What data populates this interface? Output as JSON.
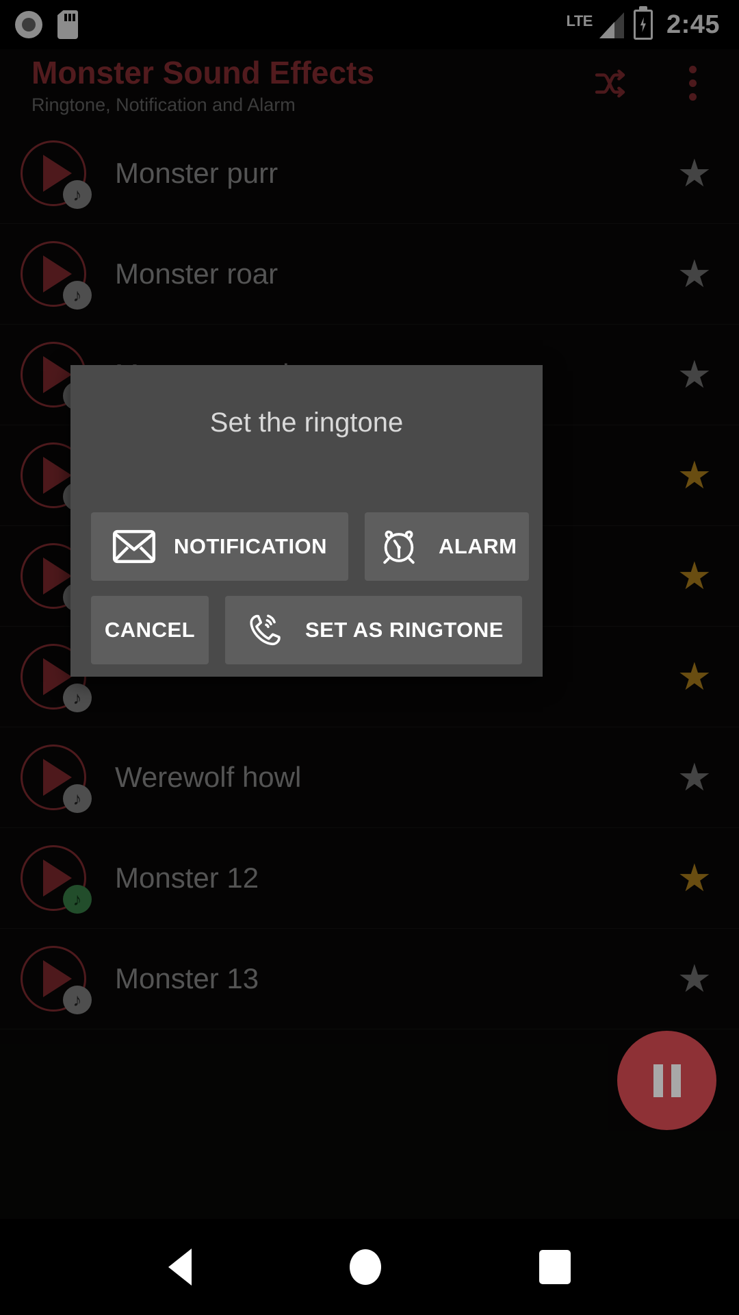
{
  "status_bar": {
    "time": "2:45",
    "network_label": "LTE",
    "icons": [
      "record-icon",
      "sdcard-icon",
      "signal-icon",
      "battery-charging-icon"
    ]
  },
  "header": {
    "title": "Monster Sound Effects",
    "subtitle": "Ringtone, Notification and Alarm",
    "shuffle_icon": "shuffle-icon",
    "overflow_icon": "overflow-menu-icon",
    "title_color": "#953237"
  },
  "sounds": [
    {
      "name": "Monster purr",
      "favorite": false,
      "playing": false
    },
    {
      "name": "Monster roar",
      "favorite": false,
      "playing": false
    },
    {
      "name": "Monster snarl or sneer",
      "favorite": false,
      "playing": false
    },
    {
      "name": "",
      "favorite": true,
      "playing": false
    },
    {
      "name": "",
      "favorite": true,
      "playing": false
    },
    {
      "name": "",
      "favorite": true,
      "playing": false
    },
    {
      "name": "Werewolf howl",
      "favorite": false,
      "playing": false
    },
    {
      "name": "Monster 12",
      "favorite": true,
      "playing": true
    },
    {
      "name": "Monster 13",
      "favorite": false,
      "playing": false
    }
  ],
  "dialog": {
    "title": "Set the ringtone",
    "buttons": {
      "notification": "NOTIFICATION",
      "alarm": "ALARM",
      "cancel": "CANCEL",
      "set_as_ringtone": "SET AS RINGTONE"
    },
    "icons": {
      "notification": "envelope-icon",
      "alarm": "alarm-clock-icon",
      "ringtone": "ringing-phone-icon"
    }
  },
  "fab": {
    "icon": "pause-icon",
    "color": "#8e3136"
  },
  "nav_bar": {
    "back": "back-icon",
    "home": "home-icon",
    "recents": "recents-icon"
  },
  "colors": {
    "accent": "#8e3136",
    "favorite_star": "#c08d1f",
    "inactive_star": "#7c7c7c",
    "background": "#0a0908",
    "dialog_bg": "#4a4a4a",
    "dialog_button": "#5e5e5e"
  }
}
